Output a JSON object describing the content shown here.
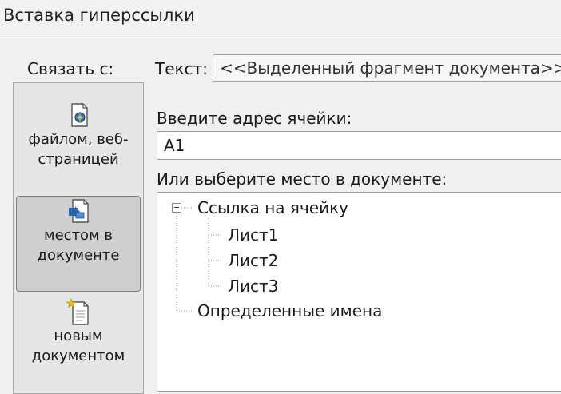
{
  "dialog": {
    "title": "Вставка гиперссылки"
  },
  "sidebar": {
    "heading": "Связать с:",
    "items": [
      {
        "label": "файлом, веб-\nстраницей",
        "icon": "web-file-icon",
        "selected": false
      },
      {
        "label": "местом в\nдокументе",
        "icon": "place-in-document-icon",
        "selected": true
      },
      {
        "label": "новым\nдокументом",
        "icon": "new-document-icon",
        "selected": false
      }
    ]
  },
  "text_field": {
    "label": "Текст:",
    "value": "<<Выделенный фрагмент документа>>"
  },
  "address_field": {
    "label": "Введите адрес ячейки:",
    "value": "A1"
  },
  "place_tree": {
    "label": "Или выберите место в документе:",
    "root": "Ссылка на ячейку",
    "sheets": [
      "Лист1",
      "Лист2",
      "Лист3"
    ],
    "defined_names": "Определенные имена"
  }
}
